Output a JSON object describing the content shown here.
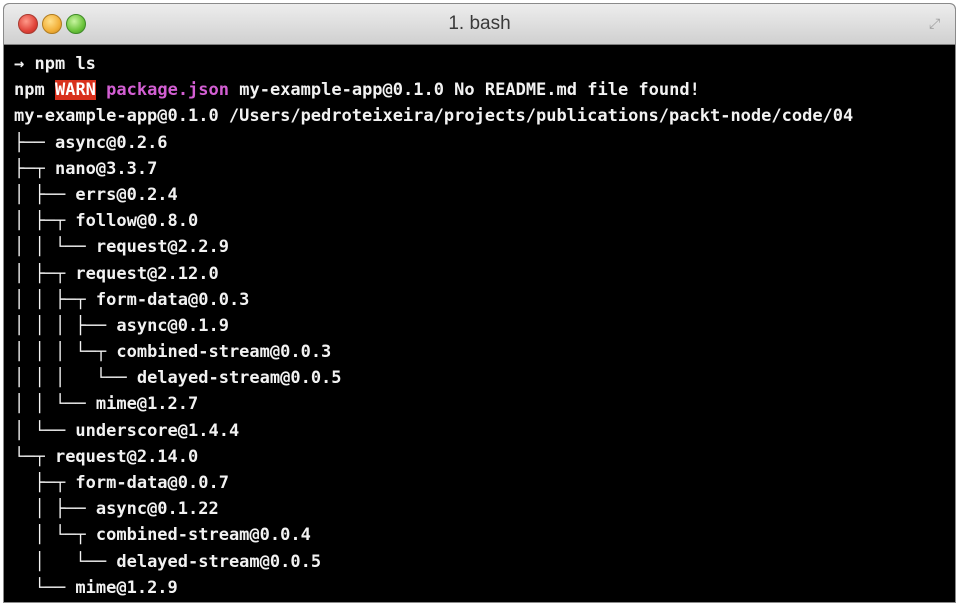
{
  "window": {
    "title": "1. bash"
  },
  "prompt": {
    "arrow": "→",
    "command": "npm ls"
  },
  "warning": {
    "prefix": "npm",
    "badge": "WARN",
    "file": "package.json",
    "message": "my-example-app@0.1.0 No README.md file found!"
  },
  "root": "my-example-app@0.1.0 /Users/pedroteixeira/projects/publications/packt-node/code/04",
  "tree": [
    {
      "prefix": "├── ",
      "name": "async@0.2.6"
    },
    {
      "prefix": "├─┬ ",
      "name": "nano@3.3.7"
    },
    {
      "prefix": "│ ├── ",
      "name": "errs@0.2.4"
    },
    {
      "prefix": "│ ├─┬ ",
      "name": "follow@0.8.0"
    },
    {
      "prefix": "│ │ └── ",
      "name": "request@2.2.9"
    },
    {
      "prefix": "│ ├─┬ ",
      "name": "request@2.12.0"
    },
    {
      "prefix": "│ │ ├─┬ ",
      "name": "form-data@0.0.3"
    },
    {
      "prefix": "│ │ │ ├── ",
      "name": "async@0.1.9"
    },
    {
      "prefix": "│ │ │ └─┬ ",
      "name": "combined-stream@0.0.3"
    },
    {
      "prefix": "│ │ │   └── ",
      "name": "delayed-stream@0.0.5"
    },
    {
      "prefix": "│ │ └── ",
      "name": "mime@1.2.7"
    },
    {
      "prefix": "│ └── ",
      "name": "underscore@1.4.4"
    },
    {
      "prefix": "└─┬ ",
      "name": "request@2.14.0"
    },
    {
      "prefix": "  ├─┬ ",
      "name": "form-data@0.0.7"
    },
    {
      "prefix": "  │ ├── ",
      "name": "async@0.1.22"
    },
    {
      "prefix": "  │ └─┬ ",
      "name": "combined-stream@0.0.4"
    },
    {
      "prefix": "  │   └── ",
      "name": "delayed-stream@0.0.5"
    },
    {
      "prefix": "  └── ",
      "name": "mime@1.2.9"
    }
  ]
}
